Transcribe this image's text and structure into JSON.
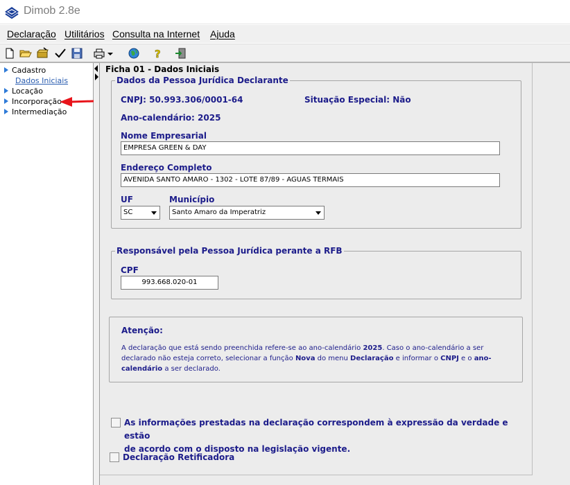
{
  "window": {
    "title": "Dimob 2.8e"
  },
  "menu": [
    "Declaração",
    "Utilitários",
    "Consulta na Internet",
    "Ajuda"
  ],
  "toolbar": {
    "icons": [
      "new-file-icon",
      "open-folder-icon",
      "open-package-icon",
      "check-icon",
      "save-disk-icon",
      "printer-icon",
      "globe-icon",
      "help-icon",
      "exit-icon"
    ]
  },
  "sidebar": {
    "items": [
      {
        "label": "Cadastro",
        "children": [
          {
            "label": "Dados Iniciais"
          }
        ]
      },
      {
        "label": "Locação"
      },
      {
        "label": "Incorporação"
      },
      {
        "label": "Intermediação"
      }
    ]
  },
  "form": {
    "title": "Ficha 01 - Dados Iniciais",
    "declarant": {
      "legend": "Dados da Pessoa Jurídica Declarante",
      "cnpj_label": "CNPJ:",
      "cnpj": "50.993.306/0001-64",
      "special_label": "Situação Especial:",
      "special": "Não",
      "year_label": "Ano-calendário:",
      "year": "2025",
      "company_label": "Nome Empresarial",
      "company": "EMPRESA GREEN & DAY",
      "address_label": "Endereço Completo",
      "address": "AVENIDA SANTO AMARO - 1302 - LOTE 87/89 - AGUAS TERMAIS",
      "uf_label": "UF",
      "uf": "SC",
      "city_label": "Município",
      "city": "Santo Amaro da Imperatriz"
    },
    "responsible": {
      "legend": "Responsável pela Pessoa Jurídica perante a RFB",
      "cpf_label": "CPF",
      "cpf": "993.668.020-01"
    },
    "notice": {
      "title": "Atenção:",
      "p1": "A declaração que está sendo preenchida refere-se ao ano-calendário ",
      "year": "2025",
      "p2": ". Caso o ano-calendário a ser declarado não esteja correto, selecionar a função ",
      "nova": "Nova",
      "p3": " do menu ",
      "declaracao": "Declaração",
      "p4": " e informar o ",
      "cnpj": "CNPJ",
      "p5": " e o ",
      "anocal": "ano-calendário",
      "p6": " a ser declarado."
    },
    "truth_check": {
      "line1": "As informações prestadas na declaração correspondem à expressão da verdade e estão",
      "line2": "de acordo com o disposto na legislação vigente."
    },
    "rectifier_label": "Declaração Retificadora"
  },
  "colors": {
    "label_blue": "#1c1c8a",
    "tree_arrow": "#2f7bd8",
    "annotation_red": "#e8141b"
  }
}
